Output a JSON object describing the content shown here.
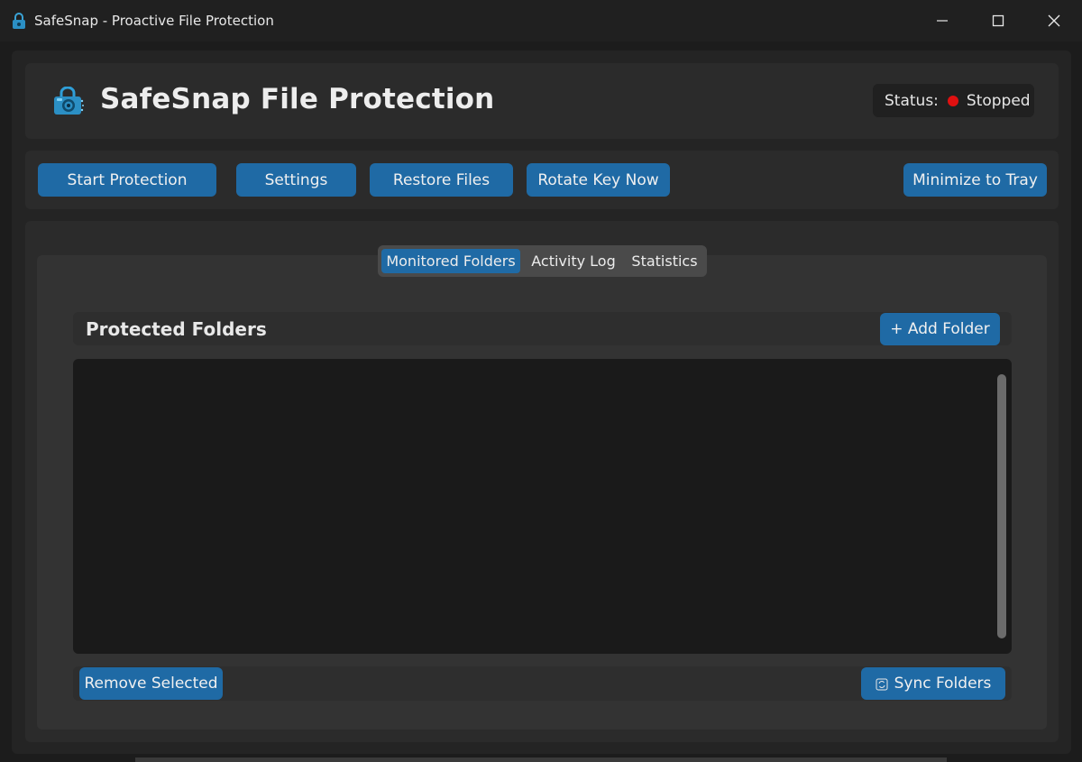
{
  "window": {
    "title": "SafeSnap - Proactive File Protection",
    "icon": "lock-icon",
    "controls": {
      "minimize": "minimize-icon",
      "maximize": "maximize-icon",
      "close": "close-icon"
    }
  },
  "header": {
    "title": "SafeSnap File Protection",
    "logo": "camera-lock-icon",
    "status_label": "Status:",
    "status_value": "Stopped",
    "status_color": "#e01010"
  },
  "toolbar": {
    "start_protection": "Start Protection",
    "settings": "Settings",
    "restore_files": "Restore Files",
    "rotate_key_now": "Rotate Key Now",
    "minimize_to_tray": "Minimize to Tray"
  },
  "tabs": [
    {
      "label": "Monitored Folders",
      "active": true
    },
    {
      "label": "Activity Log",
      "active": false
    },
    {
      "label": "Statistics",
      "active": false
    }
  ],
  "folders": {
    "title": "Protected Folders",
    "add_button": "+ Add Folder",
    "remove_button": "Remove Selected",
    "sync_button": "Sync Folders",
    "sync_icon": "sync-icon",
    "items": []
  },
  "colors": {
    "accent": "#1f6aa5",
    "background": "#242424",
    "panel": "#2b2b2b",
    "list_background": "#1a1a1a"
  }
}
